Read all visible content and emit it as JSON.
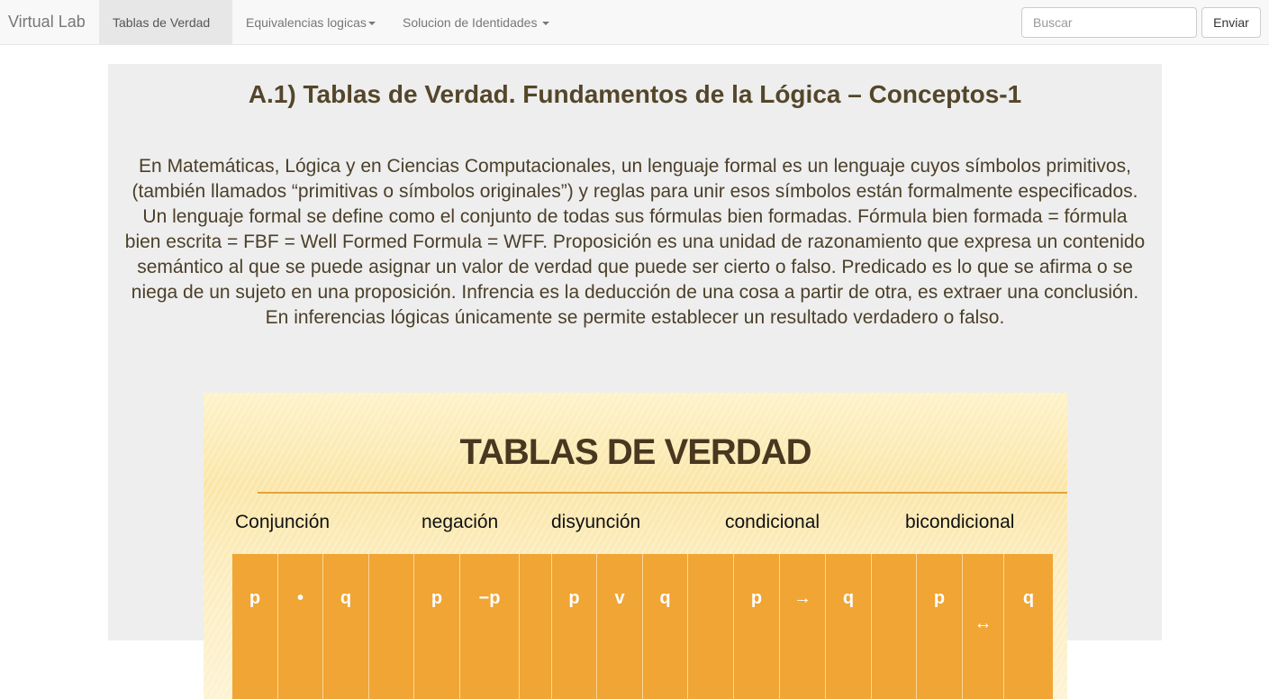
{
  "navbar": {
    "brand": "Virtual Lab",
    "items": [
      {
        "label": "Tablas de Verdad"
      },
      {
        "label": "Equivalencias logicas"
      },
      {
        "label": "Solucion de Identidades"
      }
    ],
    "search_placeholder": "Buscar",
    "send_label": "Enviar"
  },
  "content": {
    "title": "A.1) Tablas de Verdad. Fundamentos de la Lógica – Conceptos-1",
    "intro": "En Matemáticas, Lógica y en Ciencias Computacionales, un lenguaje formal es un lenguaje cuyos símbolos primitivos, (también llamados “primitivas o símbolos originales”) y reglas para unir esos símbolos están formalmente especificados. Un lenguaje formal se define como el conjunto de todas sus fórmulas bien formadas. Fórmula bien formada = fórmula bien escrita = FBF = Well Formed Formula = WFF. Proposición es una unidad de razonamiento que expresa un contenido semántico al que se puede asignar un valor de verdad que puede ser cierto o falso. Predicado es lo que se afirma o se niega de un sujeto en una proposición. Infrencia es la deducción de una cosa a partir de otra, es extraer una conclusión. En inferencias lógicas únicamente se permite establecer un resultado verdadero o falso."
  },
  "infographic": {
    "title": "TABLAS DE VERDAD",
    "operations": [
      "Conjunción",
      "negación",
      "disyunción",
      "condicional",
      "bicondicional"
    ],
    "headers": [
      "p",
      "•",
      "q",
      "",
      "p",
      "−p",
      "",
      "p",
      "v",
      "q",
      "",
      "p",
      "→",
      "q",
      "",
      "p",
      "↔",
      "q"
    ],
    "colors": {
      "table": "#f0a534",
      "title": "#4a3720",
      "accent_line": "#e4a33a"
    }
  }
}
